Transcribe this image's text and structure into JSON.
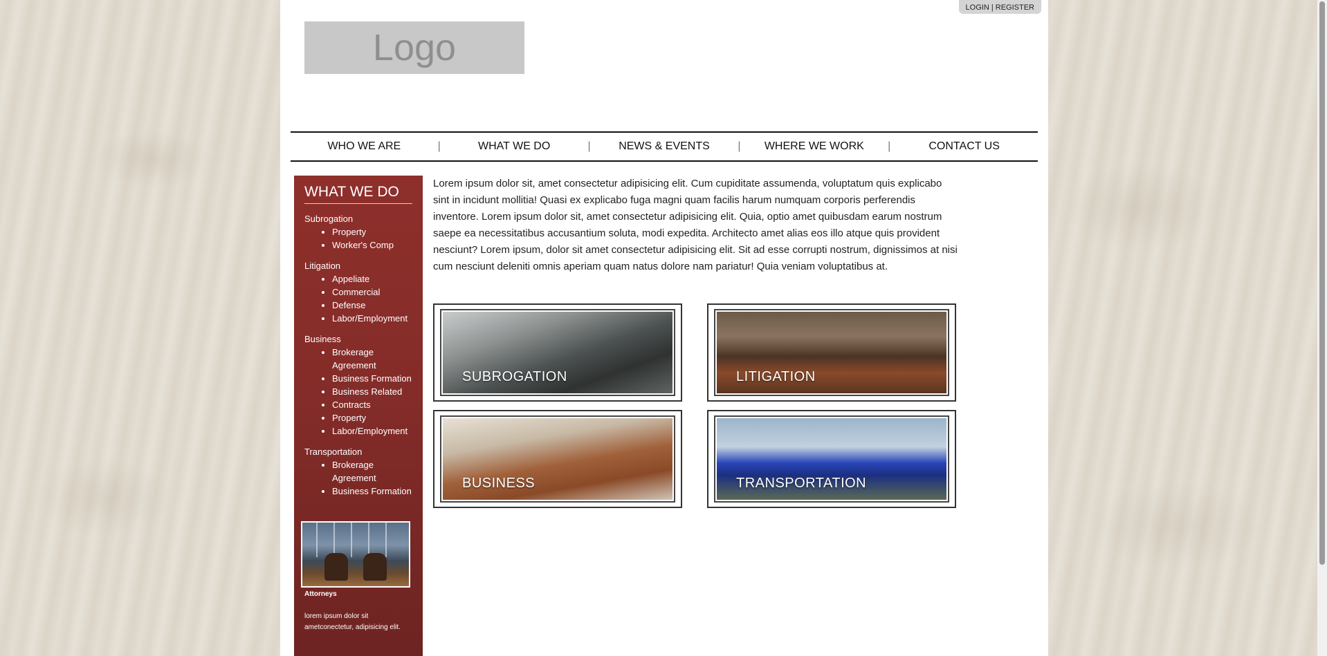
{
  "header": {
    "login_label": "LOGIN",
    "separator": "|",
    "register_label": "REGISTER",
    "logo_text": "Logo"
  },
  "nav": {
    "items": [
      "WHO WE ARE",
      "WHAT WE DO",
      "NEWS & EVENTS",
      "WHERE WE WORK",
      "CONTACT US"
    ],
    "separator": "|"
  },
  "sidebar": {
    "title": "WHAT WE DO",
    "groups": [
      {
        "label": "Subrogation",
        "items": [
          "Property",
          "Worker's Comp"
        ]
      },
      {
        "label": "Litigation",
        "items": [
          "Appeliate",
          "Commercial",
          "Defense",
          "Labor/Employment"
        ]
      },
      {
        "label": "Business",
        "items": [
          "Brokerage Agreement",
          "Business Formation",
          "Business Related",
          "Contracts",
          "Property",
          "Labor/Employment"
        ]
      },
      {
        "label": "Transportation",
        "items": [
          "Brokerage Agreement",
          "Business Formation"
        ]
      }
    ],
    "photo_title": "Attorneys",
    "photo_text": "lorem ipsum dolor sit ametconectetur, adipisicing elit."
  },
  "main": {
    "intro": "Lorem ipsum dolor sit, amet consectetur adipisicing elit. Cum cupiditate assumenda, voluptatum quis explicabo sint in incidunt mollitia! Quasi ex explicabo fuga magni quam facilis harum numquam corporis perferendis inventore. Lorem ipsum dolor sit, amet consectetur adipisicing elit. Quia, optio amet quibusdam earum nostrum saepe ea necessitatibus accusantium soluta, modi expedita. Architecto amet alias eos illo atque quis provident nesciunt? Lorem ipsum, dolor sit amet consectetur adipisicing elit. Sit ad esse corrupti nostrum, dignissimos at nisi cum nesciunt deleniti omnis aperiam quam natus dolore nam pariatur! Quia veniam voluptatibus at.",
    "tiles": [
      "SUBROGATION",
      "LITIGATION",
      "BUSINESS",
      "TRANSPORTATION"
    ]
  }
}
